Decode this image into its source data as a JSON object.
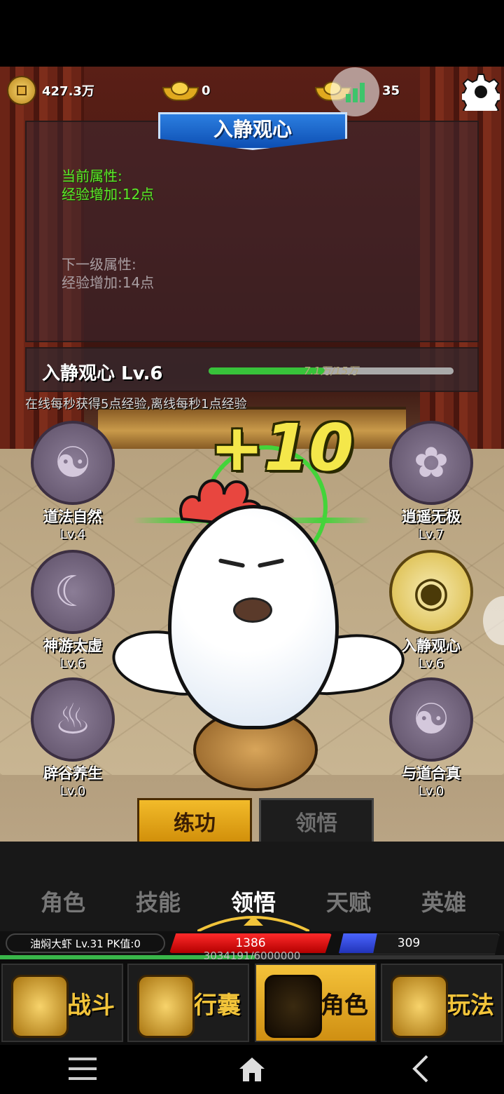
{
  "topbar": {
    "copper": "427.3万",
    "gold_ingot": "0",
    "other_ingot": "35"
  },
  "panel": {
    "title": "入静观心",
    "current_label": "当前属性:",
    "current_value": "经验增加:12点",
    "next_label": "下一级属性:",
    "next_value": "经验增加:14点",
    "level_label": "入静观心 Lv.6",
    "progress_text": "7.1万/15万",
    "progress_fraction": 0.473,
    "hint": "在线每秒获得5点经验,离线每秒1点经验"
  },
  "float_text": "+10",
  "skills": [
    {
      "name": "道法自然",
      "level": "Lv.4",
      "icon": "bagua-icon"
    },
    {
      "name": "逍遥无极",
      "level": "Lv.7",
      "icon": "lotus-icon"
    },
    {
      "name": "神游太虚",
      "level": "Lv.6",
      "icon": "cloud-swirl-icon"
    },
    {
      "name": "入静观心",
      "level": "Lv.6",
      "icon": "eye-icon"
    },
    {
      "name": "辟谷养生",
      "level": "Lv.0",
      "icon": "gourd-icon"
    },
    {
      "name": "与道合真",
      "level": "Lv.0",
      "icon": "yinyang-icon"
    }
  ],
  "buttons": {
    "practice": "练功",
    "insight": "领悟"
  },
  "tabs": [
    "角色",
    "技能",
    "领悟",
    "天赋",
    "英雄"
  ],
  "player": {
    "name_line": "油焖大虾  Lv.31  PK值:0",
    "hp": "1386",
    "mp": "309",
    "mp_fraction": 0.24,
    "exp_text": "3034191/6000000",
    "exp_fraction": 0.506
  },
  "nav": [
    "战斗",
    "行囊",
    "角色",
    "玩法"
  ],
  "colors": {
    "accent_gold": "#f2bb2a",
    "hp_red": "#e01b1b",
    "mp_blue": "#3448e0",
    "attr_green": "#5ee62a"
  }
}
